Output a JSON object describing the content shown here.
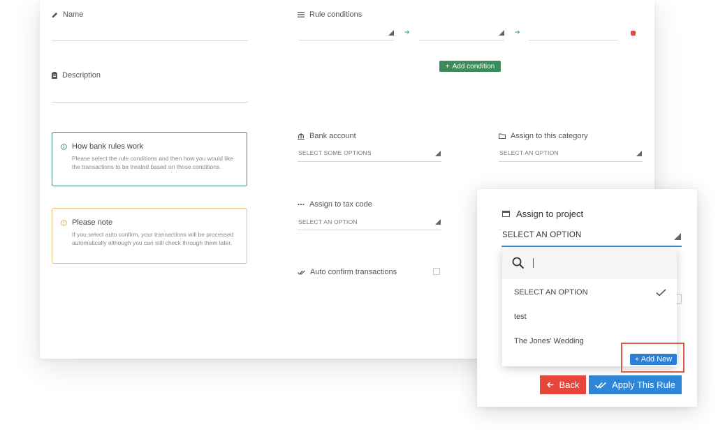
{
  "form": {
    "name_label": "Name",
    "description_label": "Description",
    "rule_conditions_label": "Rule conditions",
    "add_condition_label": "Add condition",
    "bank_account_label": "Bank account",
    "bank_account_placeholder": "SELECT SOME OPTIONS",
    "category_label": "Assign to this category",
    "category_placeholder": "SELECT AN OPTION",
    "tax_code_label": "Assign to tax code",
    "tax_code_placeholder": "SELECT AN OPTION",
    "auto_confirm_label": "Auto confirm transactions"
  },
  "info_box": {
    "title": "How bank rules work",
    "text": "Please select the rule conditions and then how you would like the transactions to be treated based on those conditions."
  },
  "note_box": {
    "title": "Please note",
    "text": "If you select auto confirm, your transactions will be processed automatically although you can still check through them later."
  },
  "project_panel": {
    "title": "Assign to project",
    "selected_value": "SELECT AN OPTION",
    "search_value": "",
    "options": [
      "SELECT AN OPTION",
      "test",
      "The Jones' Wedding"
    ],
    "add_new_label": "+ Add New",
    "back_label": "Back",
    "apply_label": "Apply This Rule"
  },
  "colors": {
    "accent_green": "#3d8b5a",
    "accent_blue": "#2f86d6",
    "danger_red": "#e5453a",
    "note_yellow": "#e8c37a"
  }
}
